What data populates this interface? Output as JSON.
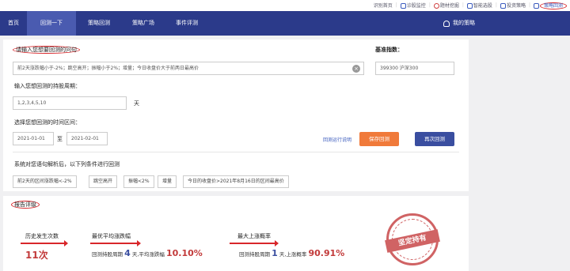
{
  "utilbar": {
    "items": [
      {
        "label": "识别首页",
        "icon": ""
      },
      {
        "label": "诊股监控",
        "icon": "chart-icon"
      },
      {
        "label": "题材挖掘",
        "icon": "target-icon"
      },
      {
        "label": "智能选股",
        "icon": "gear-icon"
      },
      {
        "label": "投资策略",
        "icon": "compass-icon"
      },
      {
        "label": "策略回测",
        "icon": "chart-icon"
      }
    ]
  },
  "nav": {
    "items": [
      "首页",
      "回测一下",
      "策略回测",
      "策略广场",
      "事件评测"
    ],
    "user": "我的策略"
  },
  "form": {
    "query_label": "请输入您想要回测的问句",
    "query_value": "前2天涨跌幅小于-2%；跳空高开；振幅小于2%；增量；今日收盘价大于前两日最高价",
    "benchmark_label": "基准指数：",
    "benchmark_value": "399300 沪深300",
    "hold_label": "输入您想回测的持股周期：",
    "hold_value": "1,2,3,4,5,10",
    "hold_unit": "天",
    "range_label": "选择您想回测的时间区间：",
    "date_from": "2021-01-01",
    "date_to_label": "至",
    "date_to": "2021-02-01",
    "link_text": "回测运行说明",
    "save_button": "保存回测",
    "rerun_button": "再次回测",
    "parsed_label": "系统对您语句解析后，以下列条件进行回测",
    "tags": [
      "前2天的区间涨跌幅<-2%",
      "跳空高开",
      "振幅<2%",
      "增量",
      "今日的收盘价>2021年8月16日的区间最高价"
    ]
  },
  "report": {
    "title": "报告评级",
    "stats": [
      {
        "title": "历史发生次数",
        "value": "11次"
      },
      {
        "title": "最优平均涨跌幅",
        "prefix": "回测持股周期",
        "days": "4",
        "mid": "天,平均涨跌幅",
        "value": "10.10%"
      },
      {
        "title": "最大上涨概率",
        "prefix": "回测持股周期",
        "days": "1",
        "mid": "天,上涨概率",
        "value": "90.91%"
      }
    ],
    "stamp": "坚定持有"
  }
}
